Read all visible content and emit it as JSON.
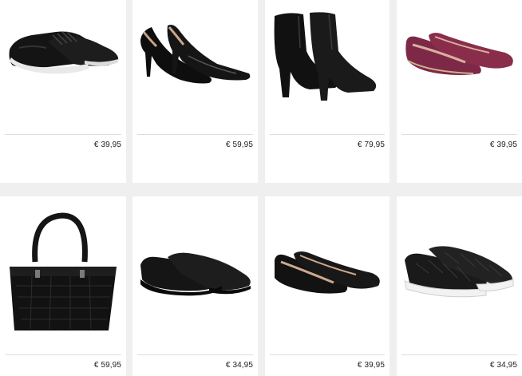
{
  "products": [
    {
      "name_icon": "black-sneaker-icon",
      "price": "€ 39,95"
    },
    {
      "name_icon": "black-patent-pump-icon",
      "price": "€ 59,95"
    },
    {
      "name_icon": "black-ankle-boot-icon",
      "price": "€ 79,95"
    },
    {
      "name_icon": "burgundy-ballet-flat-icon",
      "price": "€ 39,95"
    },
    {
      "name_icon": "black-croc-handbag-icon",
      "price": "€ 59,95"
    },
    {
      "name_icon": "black-slip-on-shoe-icon",
      "price": "€ 34,95"
    },
    {
      "name_icon": "black-ballet-flat-icon",
      "price": "€ 39,95"
    },
    {
      "name_icon": "croc-slip-on-sneaker-icon",
      "price": "€ 34,95"
    }
  ],
  "colors": {
    "page_bg": "#efefef",
    "card_bg": "#ffffff",
    "price_text": "#222222",
    "burgundy": "#8a2d4a"
  }
}
